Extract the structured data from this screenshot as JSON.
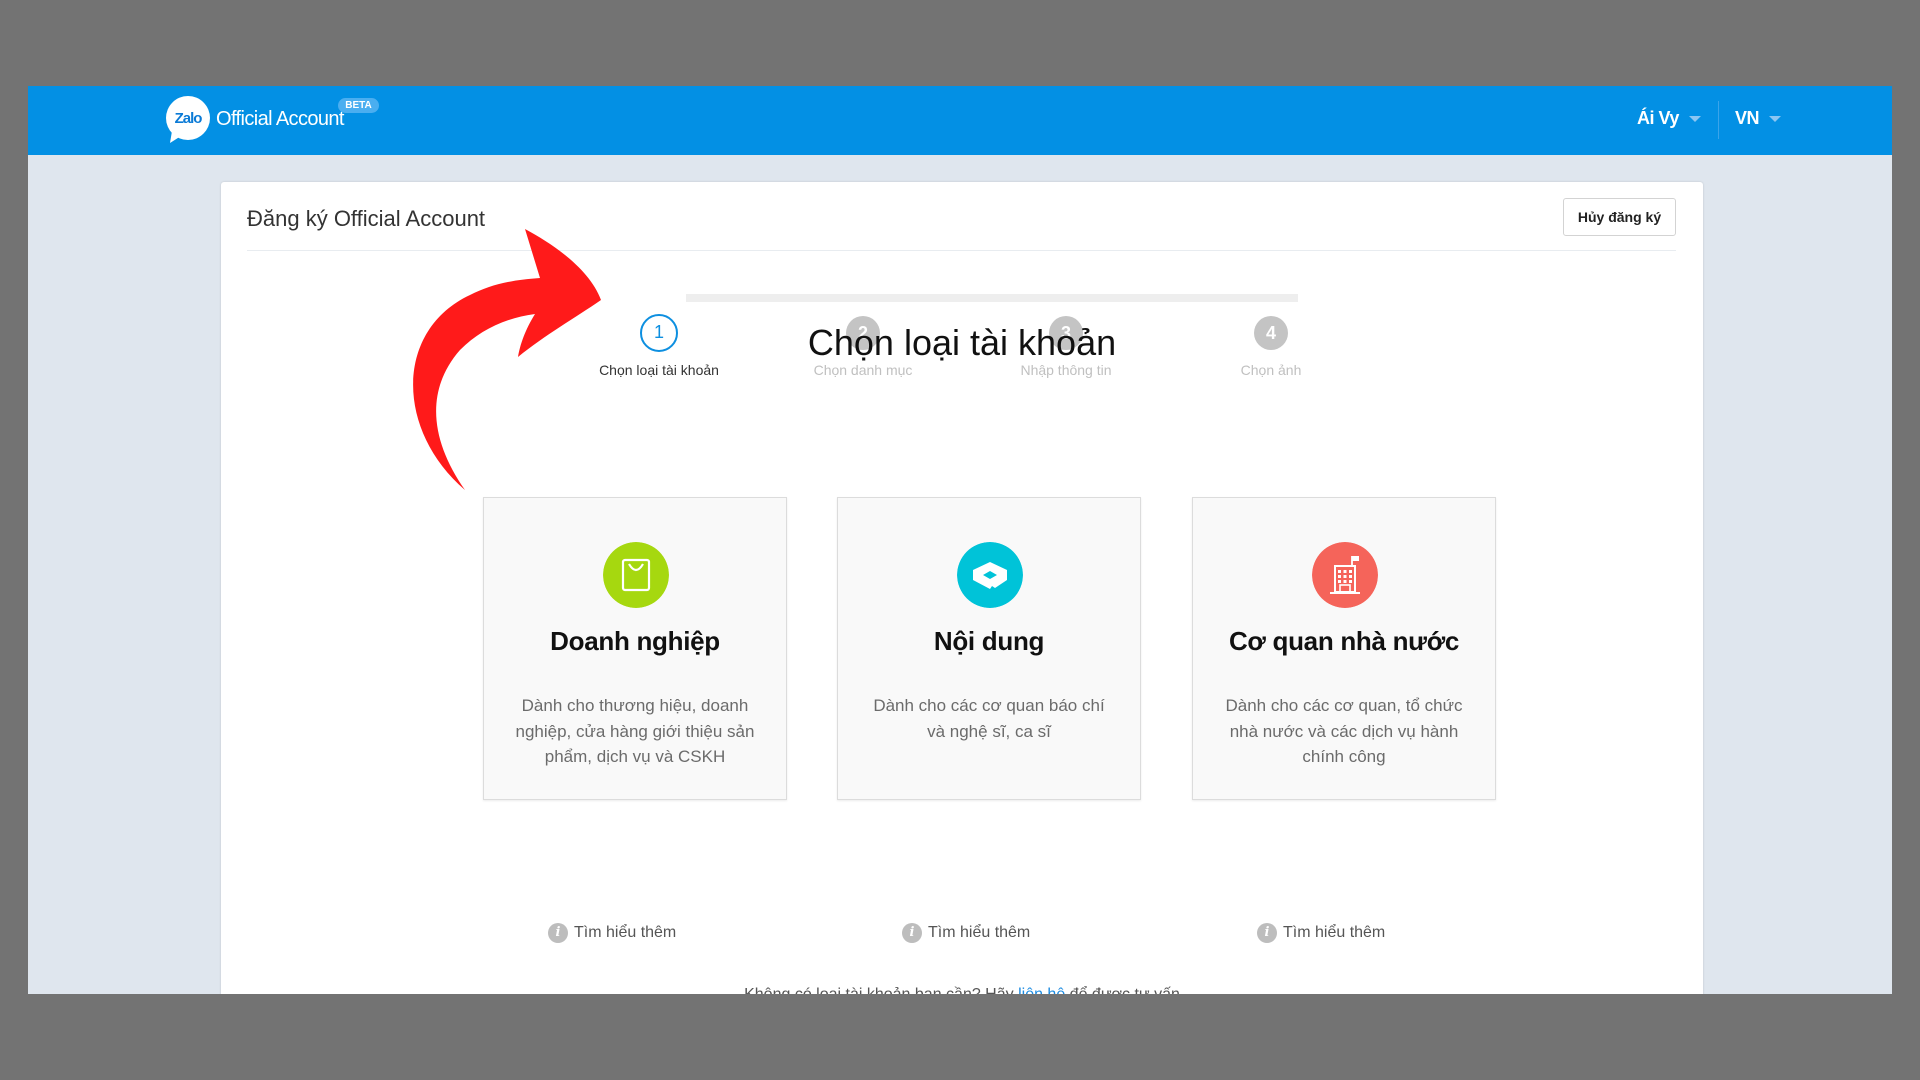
{
  "topbar": {
    "brand_logo_text": "Zalo",
    "brand_name": "Official Account",
    "beta_badge": "BETA",
    "user_name": "Ái Vy",
    "language": "VN"
  },
  "page": {
    "title": "Đăng ký Official Account",
    "cancel_button": "Hủy đăng ký",
    "section_title": "Chọn loại tài khoản"
  },
  "steps": [
    {
      "number": "1",
      "label": "Chọn loại tài khoản",
      "state": "active"
    },
    {
      "number": "2",
      "label": "Chọn danh mục",
      "state": "inactive"
    },
    {
      "number": "3",
      "label": "Nhập thông tin",
      "state": "inactive"
    },
    {
      "number": "4",
      "label": "Chọn ảnh",
      "state": "inactive"
    }
  ],
  "account_types": [
    {
      "name": "Doanh nghiệp",
      "description": "Dành cho thương hiệu, doanh nghiệp, cửa hàng giới thiệu sản phẩm, dịch vụ và CSKH",
      "icon": "shopping-bag-icon",
      "color": "#a6d80f",
      "learn_more": "Tìm hiểu thêm"
    },
    {
      "name": "Nội dung",
      "description": "Dành cho các cơ quan báo chí và nghệ sĩ, ca sĩ",
      "icon": "content-icon",
      "color": "#00c3d8",
      "learn_more": "Tìm hiểu thêm"
    },
    {
      "name": "Cơ quan nhà nước",
      "description": "Dành cho các cơ quan, tổ chức nhà nước và các dịch vụ hành chính công",
      "icon": "government-building-icon",
      "color": "#f5645a",
      "learn_more": "Tìm hiểu thêm"
    }
  ],
  "footer": {
    "prefix": "Không có loại tài khoản bạn cần? Hãy ",
    "link": "liên hệ",
    "suffix": " để được tư vấn"
  },
  "colors": {
    "topbar": "#0390e4",
    "accent": "#0d8fe0",
    "annotation_arrow": "#ff1a1a"
  }
}
